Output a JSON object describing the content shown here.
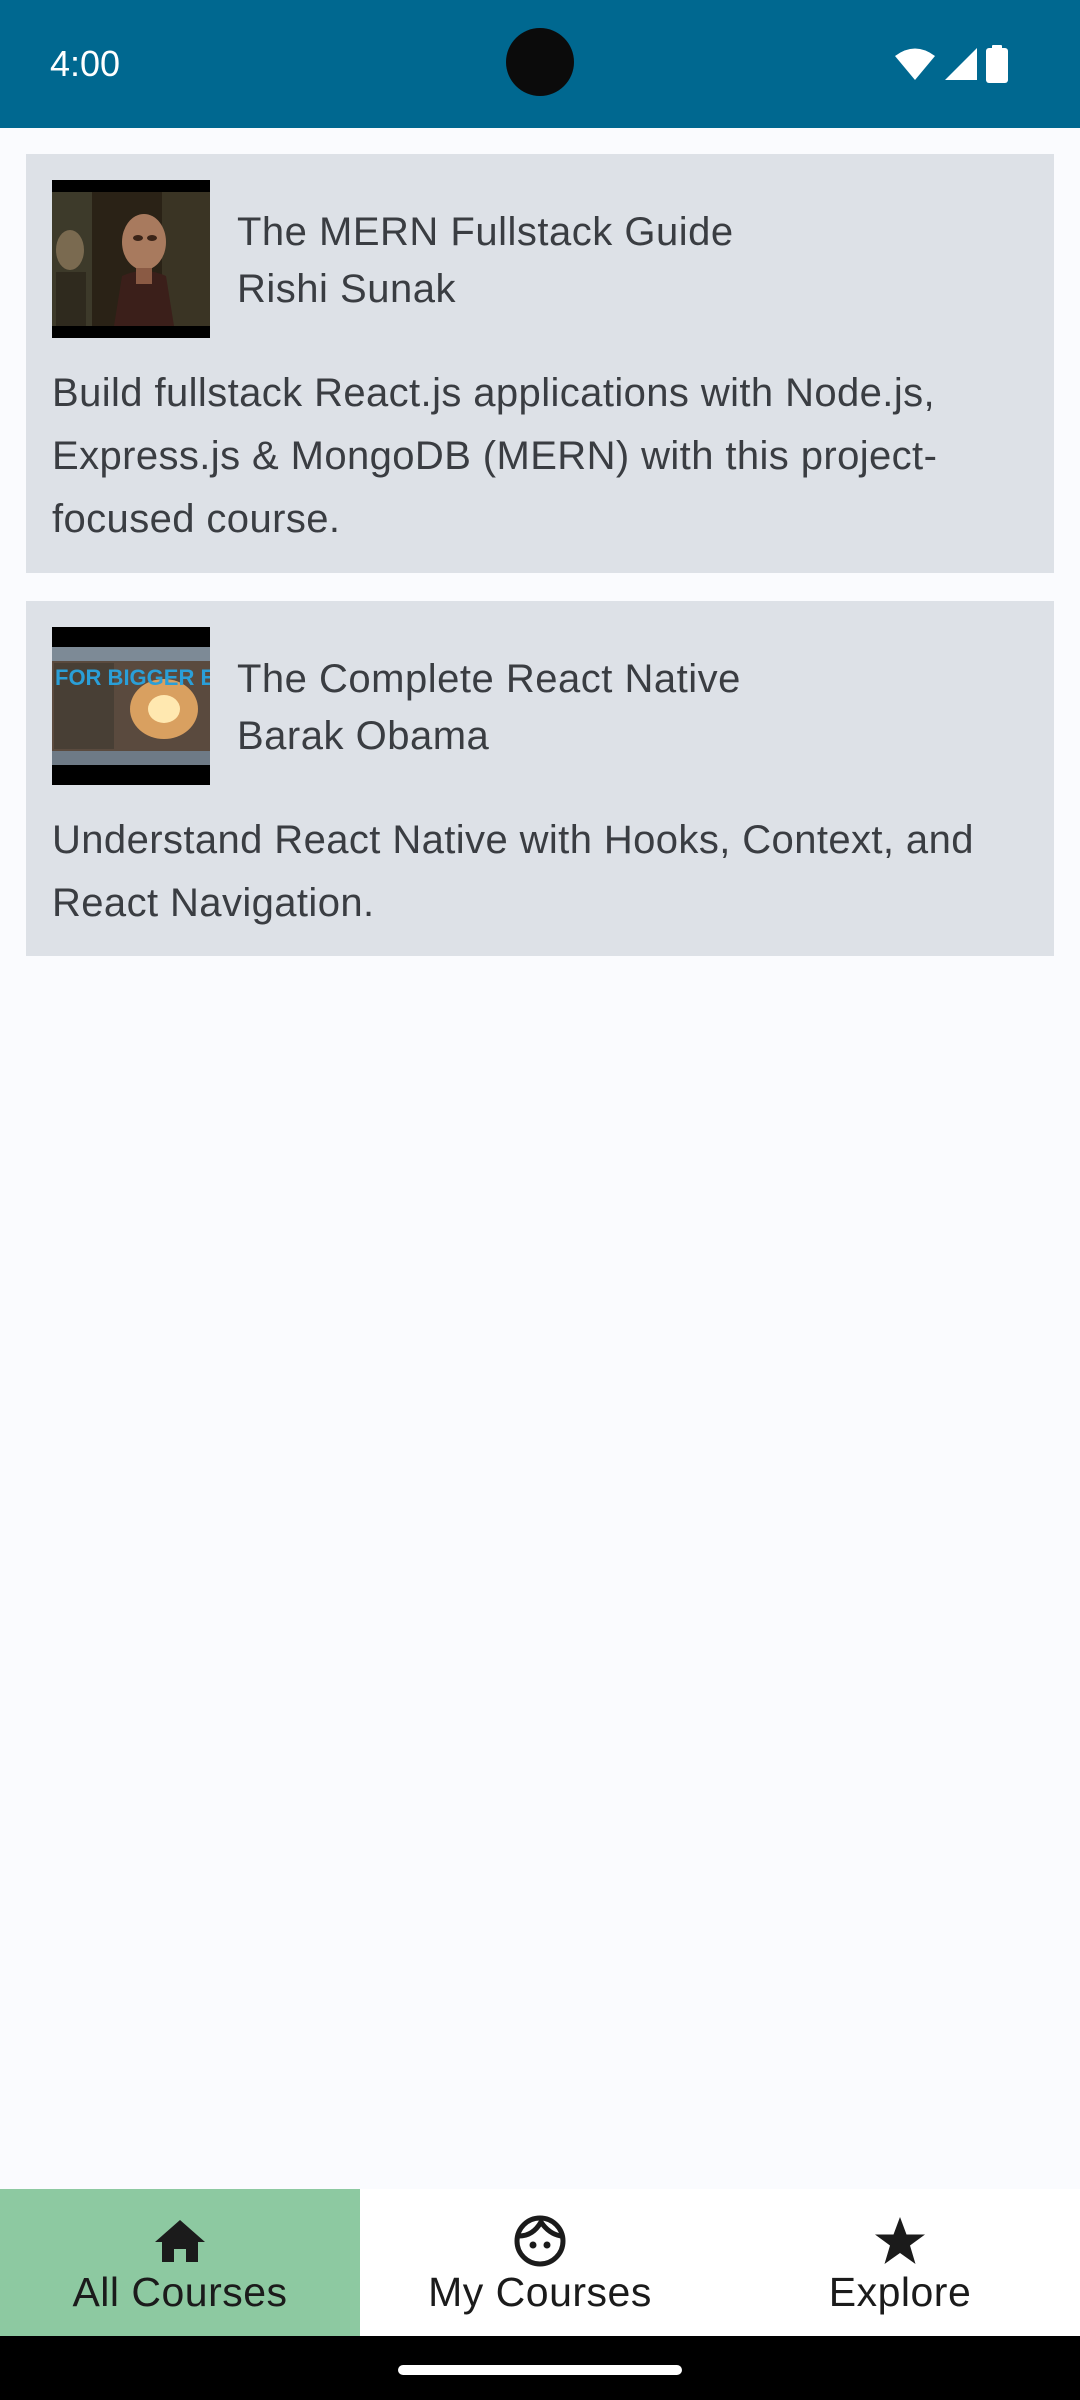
{
  "status_bar": {
    "time": "4:00",
    "background": "#006890",
    "icons": [
      "wifi-icon",
      "cellular-signal-icon",
      "battery-icon"
    ]
  },
  "courses": [
    {
      "title": "The MERN Fullstack Guide",
      "author": "Rishi Sunak",
      "description": "Build fullstack React.js applications with Node.js, Express.js & MongoDB (MERN) with this project-focused course.",
      "thumbnail": "video-thumbnail-figure-in-dark-room"
    },
    {
      "title": "The Complete React Native",
      "author": "Barak Obama",
      "description": "Understand React Native with Hooks, Context, and React Navigation.",
      "thumbnail": "video-thumbnail-for-bigger-escapes",
      "thumbnail_text": "FOR BIGGER ESCAPES"
    }
  ],
  "bottom_nav": {
    "items": [
      {
        "label": "All Courses",
        "icon": "home-icon",
        "active": true
      },
      {
        "label": "My Courses",
        "icon": "face-icon",
        "active": false
      },
      {
        "label": "Explore",
        "icon": "star-icon",
        "active": false
      }
    ],
    "active_color": "#8dc9a1"
  },
  "colors": {
    "card_background": "#dde1e7",
    "page_background": "#fafbfe",
    "text": "#3a3d42"
  }
}
